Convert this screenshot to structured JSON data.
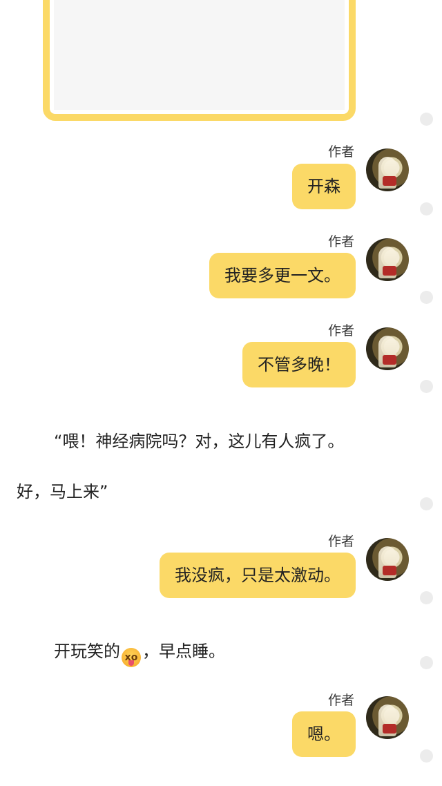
{
  "messages": [
    {
      "author": "作者",
      "text": "开森"
    },
    {
      "author": "作者",
      "text": "我要多更一文。"
    },
    {
      "author": "作者",
      "text": "不管多晚！"
    },
    {
      "author": "作者",
      "text": "我没疯，只是太激动。"
    },
    {
      "author": "作者",
      "text": "嗯。"
    }
  ],
  "narration": {
    "line1": "“喂！神经病院吗？对，这儿有人疯了。",
    "line2": "好，马上来”",
    "line3_before_emoji": "开玩笑的",
    "emoji": "xo",
    "line3_after_emoji": "，早点睡。"
  },
  "icons": {
    "emoji_name": "squinting-face-with-tongue-emoji",
    "avatar_name": "author-avatar"
  },
  "colors": {
    "bubble": "#fbd967",
    "card_border": "#fbd967",
    "dot": "#ececec",
    "text": "#222222"
  }
}
